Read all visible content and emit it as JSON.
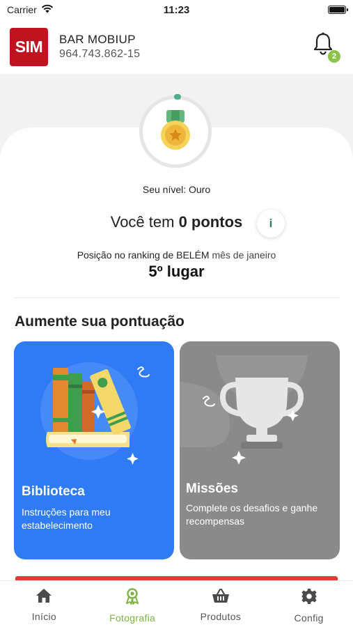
{
  "status_bar": {
    "carrier": "Carrier",
    "time": "11:23"
  },
  "header": {
    "logo_text": "SIM",
    "business_name": "BAR MOBIUP",
    "business_id": "964.743.862-15",
    "notification_count": "2",
    "colors": {
      "logo": "#c1121f",
      "badge": "#8bc34a"
    }
  },
  "level": {
    "label": "Seu nível: Ouro",
    "icon": "gold-medal-icon"
  },
  "points": {
    "prefix": "Você tem",
    "value": "0 pontos",
    "info_label": "i"
  },
  "ranking": {
    "prefix": "Posição no ranking de BELÉM",
    "period": "mês de janeiro",
    "place": "5º lugar"
  },
  "section_title": "Aumente sua pontuação",
  "cards": [
    {
      "title": "Biblioteca",
      "description": "Instruções para meu estabelecimento",
      "color": "#2f7bf6",
      "icon": "books-icon"
    },
    {
      "title": "Missões",
      "description": "Complete os desafios e ganhe recompensas",
      "color": "#8a8a8a",
      "icon": "trophy-icon"
    }
  ],
  "tabs": [
    {
      "label": "Início",
      "icon": "home-icon",
      "active": false
    },
    {
      "label": "Fotografia",
      "icon": "award-icon",
      "active": true
    },
    {
      "label": "Produtos",
      "icon": "basket-icon",
      "active": false
    },
    {
      "label": "Config",
      "icon": "gear-icon",
      "active": false
    }
  ],
  "colors": {
    "active_tab": "#7cb342",
    "accent_red": "#e53935"
  }
}
